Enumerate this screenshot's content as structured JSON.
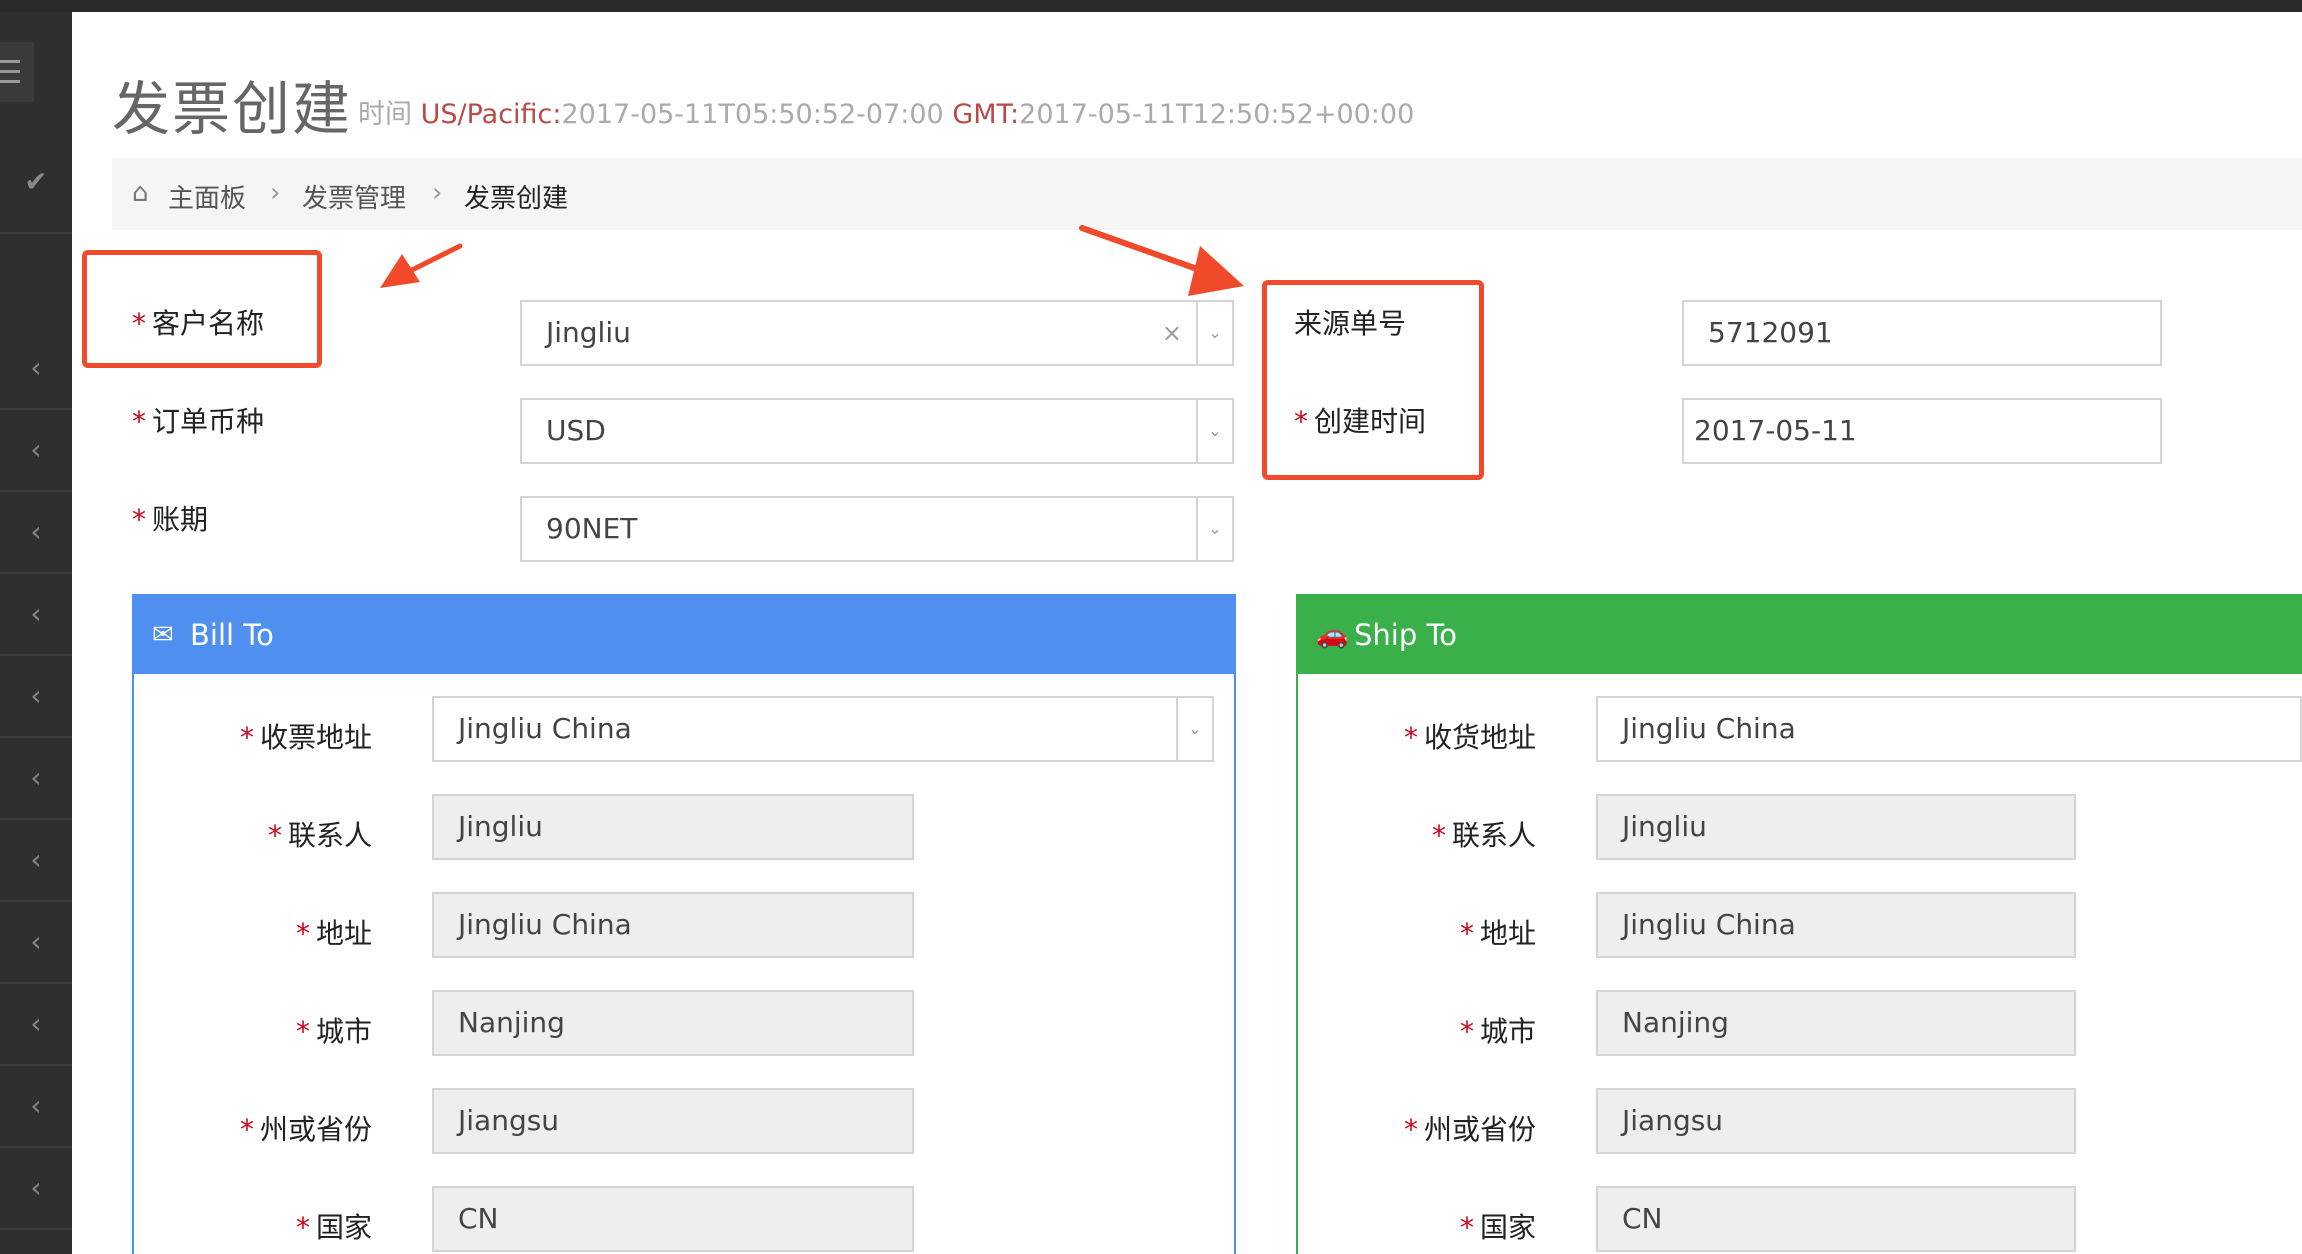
{
  "header": {
    "title": "发票创建",
    "time_label": "时间",
    "tz1": "US/Pacific:",
    "time1": "2017-05-11T05:50:52-07:00",
    "tz2": "GMT:",
    "time2": "2017-05-11T12:50:52+00:00"
  },
  "breadcrumb": {
    "home": "主面板",
    "parent": "发票管理",
    "current": "发票创建"
  },
  "form": {
    "customer_label": "客户名称",
    "customer_value": "Jingliu",
    "currency_label": "订单币种",
    "currency_value": "USD",
    "terms_label": "账期",
    "terms_value": "90NET",
    "source_label": "来源单号",
    "source_value": "5712091",
    "created_label": "创建时间",
    "created_value": "2017-05-11"
  },
  "bill_to": {
    "title": "Bill To",
    "address_label": "收票地址",
    "address_value": "Jingliu China",
    "contact_label": "联系人",
    "contact_value": "Jingliu",
    "street_label": "地址",
    "street_value": "Jingliu China",
    "city_label": "城市",
    "city_value": "Nanjing",
    "state_label": "州或省份",
    "state_value": "Jiangsu",
    "country_label": "国家",
    "country_value": "CN"
  },
  "ship_to": {
    "title": "Ship To",
    "address_label": "收货地址",
    "address_value": "Jingliu China",
    "contact_label": "联系人",
    "contact_value": "Jingliu",
    "street_label": "地址",
    "street_value": "Jingliu China",
    "city_label": "城市",
    "city_value": "Nanjing",
    "state_label": "州或省份",
    "state_value": "Jiangsu",
    "country_label": "国家",
    "country_value": "CN"
  },
  "colors": {
    "bill_header": "#4f8ff0",
    "ship_header": "#3ab04a",
    "annotation": "#f04a2a",
    "required": "#d0021b"
  },
  "icons": {
    "home": "home-icon",
    "bill": "envelope-icon",
    "ship": "car-icon",
    "menu": "menu-icon",
    "check": "check-icon",
    "collapse": "chevron-left-icon"
  }
}
